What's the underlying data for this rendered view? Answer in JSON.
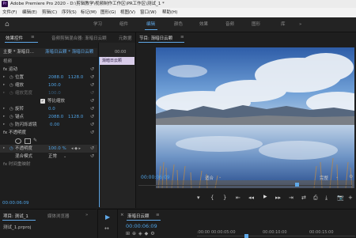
{
  "titlebar": {
    "app_icon": "Pr",
    "title": "Adobe Premiere Pro 2020 - D:\\剪辑教学\\视频制作工作区\\PR工作区\\测试_1 *"
  },
  "menu": [
    "文件(F)",
    "编辑(E)",
    "剪辑(C)",
    "序列(S)",
    "标记(M)",
    "图形(G)",
    "视图(V)",
    "窗口(W)",
    "帮助(H)"
  ],
  "workspace": {
    "tabs": [
      "学习",
      "组件",
      "编辑",
      "颜色",
      "效果",
      "音频",
      "图形",
      "库"
    ],
    "active_index": 2,
    "more_icon": "»"
  },
  "effect_controls": {
    "tabs": [
      "效果控件",
      "音频剪辑混合器: 渐暗日云颗",
      "元数据"
    ],
    "menu_icon": "≡",
    "master_label": "主要 * 渐暗日...",
    "sequence_label": "渐暗日云颗 * 渐暗日云颗",
    "clip_bar_label": "渐暗日云颗",
    "ruler_time": "00:00",
    "section_video": "视频",
    "motion_header": "fx 运动",
    "rows": [
      {
        "label": "位置",
        "v1": "2088.0",
        "v2": "1128.0",
        "stopwatch": true,
        "reset": true
      },
      {
        "label": "缩放",
        "v1": "100.0",
        "v2": "",
        "stopwatch": true,
        "reset": true
      },
      {
        "label": "缩放宽度",
        "v1": "100.0",
        "v2": "",
        "stopwatch": true,
        "reset": true,
        "dim": true
      },
      {
        "label": "",
        "checkbox_label": "等比缩放",
        "checked": true
      },
      {
        "label": "旋转",
        "v1": "0.0",
        "v2": "",
        "stopwatch": true,
        "reset": true
      },
      {
        "label": "锚点",
        "v1": "2088.0",
        "v2": "1128.0",
        "stopwatch": true,
        "reset": true
      },
      {
        "label": "防闪烁滤镜",
        "v1": "0.00",
        "v2": "",
        "stopwatch": true,
        "reset": true
      }
    ],
    "opacity_header": "fx 不透明度",
    "opacity_rows": [
      {
        "label": "不透明度",
        "v1": "100.0 %",
        "stopwatch": true,
        "reset": true
      },
      {
        "label": "混合模式",
        "v1": "正常",
        "dropdown": true,
        "reset": true
      }
    ],
    "time_remap_header": "fx 时间重映射",
    "timecode": "00:00:06:09"
  },
  "program": {
    "title": "节目: 渐暗日云颗",
    "menu_icon": "≡",
    "timecode": "00:00:06:09",
    "fit_label": "适合",
    "full_label": "完整",
    "image_alt": "湖面倒映蓝天白云与远山的风景",
    "transport": [
      "▾",
      "{",
      "}",
      "⇤",
      "◂◂",
      "▸",
      "▸▸",
      "⇥",
      "⇄",
      "⎙",
      "⤓",
      "📷",
      "⊕",
      "+"
    ]
  },
  "project": {
    "tabs": [
      "项目: 测试_1",
      "媒体浏览器"
    ],
    "more_icon": "»",
    "item": "测试_1.prproj"
  },
  "tools": [
    "▶",
    "↔",
    "✂"
  ],
  "timeline": {
    "title": "渐暗日云颗",
    "close_icon": "×",
    "menu_icon": "≡",
    "timecode": "00:00:06:09",
    "ruler": [
      "00:00",
      "00:00:05:00",
      "00:00:10:00",
      "00:00:15:00",
      "00:00:20:00"
    ],
    "ruler_prefix": ":00:00"
  },
  "colors": {
    "accent": "#5fa8e8",
    "timecode": "#4fa3e6",
    "selected_clip": "#a78ad8"
  }
}
